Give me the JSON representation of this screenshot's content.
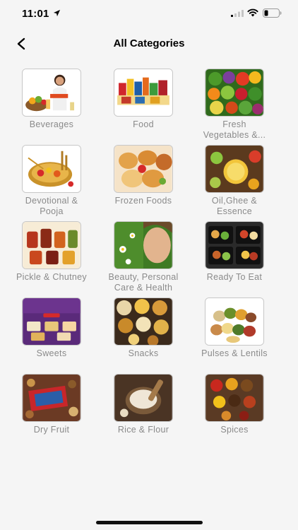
{
  "status_bar": {
    "time": "11:01"
  },
  "nav": {
    "title": "All Categories",
    "back_icon": "chevron-left-icon"
  },
  "categories": [
    {
      "label": "Beverages",
      "icon": "beverages-image"
    },
    {
      "label": "Food",
      "icon": "food-image"
    },
    {
      "label": "Fresh\nVegetables &...",
      "icon": "vegetables-image"
    },
    {
      "label": "Devotional &\nPooja",
      "icon": "devotional-image"
    },
    {
      "label": "Frozen Foods",
      "icon": "frozen-foods-image"
    },
    {
      "label": "Oil,Ghee &\nEssence",
      "icon": "oil-ghee-image"
    },
    {
      "label": "Pickle & Chutney",
      "icon": "pickle-image"
    },
    {
      "label": "Beauty, Personal\nCare & Health",
      "icon": "beauty-image"
    },
    {
      "label": "Ready To Eat",
      "icon": "ready-to-eat-image"
    },
    {
      "label": "Sweets",
      "icon": "sweets-image"
    },
    {
      "label": "Snacks",
      "icon": "snacks-image"
    },
    {
      "label": "Pulses & Lentils",
      "icon": "pulses-image"
    },
    {
      "label": "Dry Fruit",
      "icon": "dry-fruit-image"
    },
    {
      "label": "Rice & Flour",
      "icon": "rice-flour-image"
    },
    {
      "label": "Spices",
      "icon": "spices-image"
    }
  ]
}
